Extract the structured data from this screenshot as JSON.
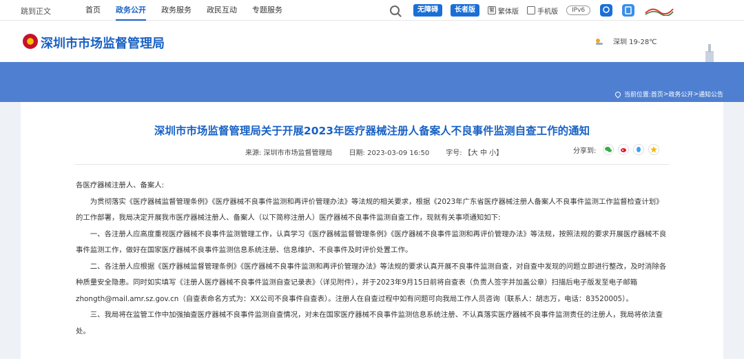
{
  "topbar": {
    "skip": "跳到正文",
    "nav": [
      "首页",
      "政务公开",
      "政务服务",
      "政民互动",
      "专题服务"
    ],
    "active_index": 1,
    "barrier_free": "无障碍",
    "senior": "长者版",
    "traditional": "繁体版",
    "mobile": "手机版",
    "ipv6": "IPv6"
  },
  "header": {
    "site_title": "深圳市市场监督管理局",
    "weather": "深圳 19-28℃"
  },
  "breadcrumb": {
    "label": "当前位置:",
    "items": [
      "首页",
      "政务公开",
      "通知公告"
    ],
    "sep": " > "
  },
  "article": {
    "title": "深圳市市场监督管理局关于开展2023年医疗器械注册人备案人不良事件监测自查工作的通知",
    "source": "来源: 深圳市市场监督管理局",
    "date": "日期: 2023-03-09 16:50",
    "fontsize": "字号: 【大 中 小】",
    "share_label": "分享到:",
    "paragraphs": [
      "各医疗器械注册人、备案人:",
      "为贯彻落实《医疗器械监督管理条例》《医疗器械不良事件监测和再评价管理办法》等法规的相关要求，根据《2023年广东省医疗器械注册人备案人不良事件监测工作监督检查计划》的工作部署，我局决定开展我市医疗器械注册人、备案人（以下简称注册人）医疗器械不良事件监测自查工作，现就有关事项通知如下:",
      "一、各注册人应高度重视医疗器械不良事件监测管理工作，认真学习《医疗器械监督管理条例》《医疗器械不良事件监测和再评价管理办法》等法规，按照法规的要求开展医疗器械不良事件监测工作，做好在国家医疗器械不良事件监测信息系统注册、信息维护、不良事件及时评价处置工作。",
      "二、各注册人应根据《医疗器械监督管理条例》《医疗器械不良事件监测和再评价管理办法》等法规的要求认真开展不良事件监测自查，对自查中发现的问题立即进行整改，及时消除各种质量安全隐患。同时如实填写《注册人医疗器械不良事件监测自查记录表》（详见附件），并于2023年9月15日前将自查表（负责人签字并加盖公章）扫描后电子版发至电子邮箱zhongth@mail.amr.sz.gov.cn（自查表命名方式为：XX公司不良事件自查表）。注册人在自查过程中如有问题可向我局工作人员咨询（联系人：胡志万，电话：83520005）。",
      "三、我局将在监管工作中加强抽查医疗器械不良事件监测自查情况，对未在国家医疗器械不良事件监测信息系统注册、不认真落实医疗器械不良事件监测责任的注册人，我局将依法查处。"
    ]
  },
  "colors": {
    "brand_blue": "#1861c4",
    "banner": "#4f7fd0",
    "wechat": "#31b048",
    "weibo": "#e6162d",
    "qq": "#3aa3f0",
    "qzone": "#f5b700"
  }
}
